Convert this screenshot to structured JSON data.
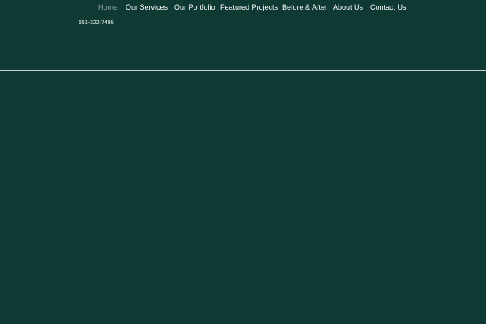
{
  "nav": {
    "items": [
      {
        "label": "Home",
        "active": true
      },
      {
        "label": "Our Services",
        "active": false
      },
      {
        "label": "Our Portfolio",
        "active": false
      },
      {
        "label": "Featured Projects",
        "active": false
      },
      {
        "label": "Before & After",
        "active": false
      },
      {
        "label": "About Us",
        "active": false
      },
      {
        "label": "Contact Us",
        "active": false
      }
    ]
  },
  "header": {
    "phone": "651-322-7499"
  },
  "colors": {
    "background": "#0f3a33",
    "nav_text": "#ffffff",
    "nav_active_text": "#8fa19c",
    "divider": "#c8d0cd"
  }
}
